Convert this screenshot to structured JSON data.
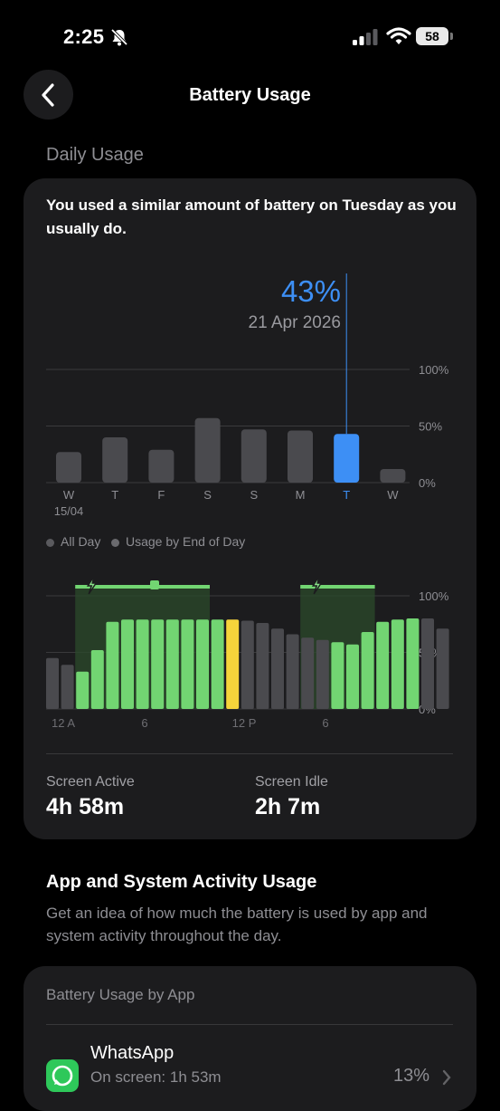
{
  "status_bar": {
    "time": "2:25",
    "battery_level": "58",
    "silent_icon": "bell-slash-icon"
  },
  "header": {
    "title": "Battery Usage",
    "back_icon": "chevron-left-icon"
  },
  "daily_usage": {
    "section_title": "Daily Usage",
    "summary": "You used a similar amount of battery on Tuesday as you usually do.",
    "selected_value": "43%",
    "selected_date": "21 Apr 2026",
    "legend": [
      "All Day",
      "Usage by End of Day"
    ]
  },
  "screen_stats": {
    "active_label": "Screen Active",
    "active_value": "4h 58m",
    "idle_label": "Screen Idle",
    "idle_value": "2h 7m"
  },
  "app_activity": {
    "title": "App and System Activity Usage",
    "description": "Get an idea of how much the battery is used by app and system activity throughout the day."
  },
  "by_app": {
    "title": "Battery Usage by App",
    "apps": [
      {
        "name": "WhatsApp",
        "detail": "On screen: 1h 53m",
        "percent": "13%",
        "icon": "whatsapp-icon"
      }
    ]
  },
  "colors": {
    "accent_blue": "#3d8ff5",
    "charging_green": "#72d572",
    "low_power_yellow": "#f6d43b",
    "bar_gray": "#4a4a4e"
  },
  "chart_data": [
    {
      "type": "bar",
      "title": "",
      "categories": [
        "W",
        "T",
        "F",
        "S",
        "S",
        "M",
        "T",
        "W"
      ],
      "sub_labels": [
        "15/04",
        "",
        "",
        "",
        "",
        "",
        "",
        ""
      ],
      "values": [
        27,
        40,
        29,
        57,
        47,
        46,
        43,
        12
      ],
      "selected_index": 6,
      "y_ticks": [
        "100%",
        "50%",
        "0%"
      ],
      "ylim": [
        0,
        100
      ],
      "grid": true
    },
    {
      "type": "bar",
      "title": "",
      "x_ticks": [
        "12 A",
        "6",
        "12 P",
        "6"
      ],
      "y_ticks": [
        "100%",
        "50%",
        "0%"
      ],
      "ylim": [
        0,
        100
      ],
      "values": [
        45,
        39,
        33,
        52,
        77,
        79,
        79,
        79,
        79,
        79,
        79,
        79,
        79,
        78,
        76,
        71,
        66,
        63,
        61,
        59,
        57,
        68,
        77,
        79,
        80,
        80,
        71
      ],
      "state": [
        "gray",
        "gray",
        "green",
        "green",
        "green",
        "green",
        "green",
        "green",
        "green",
        "green",
        "green",
        "green",
        "yellow",
        "gray",
        "gray",
        "gray",
        "gray",
        "gray",
        "gray",
        "green",
        "green",
        "green",
        "green",
        "green",
        "green",
        "gray",
        "gray"
      ],
      "charging_periods": [
        [
          2,
          10
        ],
        [
          17,
          21
        ]
      ],
      "grid": true
    }
  ]
}
